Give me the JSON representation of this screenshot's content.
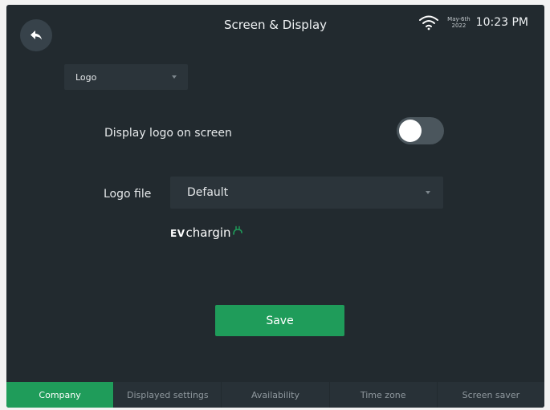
{
  "header": {
    "title": "Screen & Display",
    "date_month_day": "May-6th",
    "date_year": "2022",
    "time": "10:23 PM"
  },
  "section_select": {
    "value": "Logo"
  },
  "display_logo": {
    "label": "Display logo on screen",
    "enabled": false
  },
  "logo_file": {
    "label": "Logo file",
    "value": "Default"
  },
  "logo_preview": {
    "prefix": "EV",
    "text": "chargin"
  },
  "save_label": "Save",
  "tabs": [
    {
      "label": "Company",
      "active": true
    },
    {
      "label": "Displayed settings",
      "active": false
    },
    {
      "label": "Availability",
      "active": false
    },
    {
      "label": "Time zone",
      "active": false
    },
    {
      "label": "Screen saver",
      "active": false
    }
  ],
  "colors": {
    "accent": "#1f9c5a",
    "background": "#222a2f",
    "control": "#2b343a"
  }
}
